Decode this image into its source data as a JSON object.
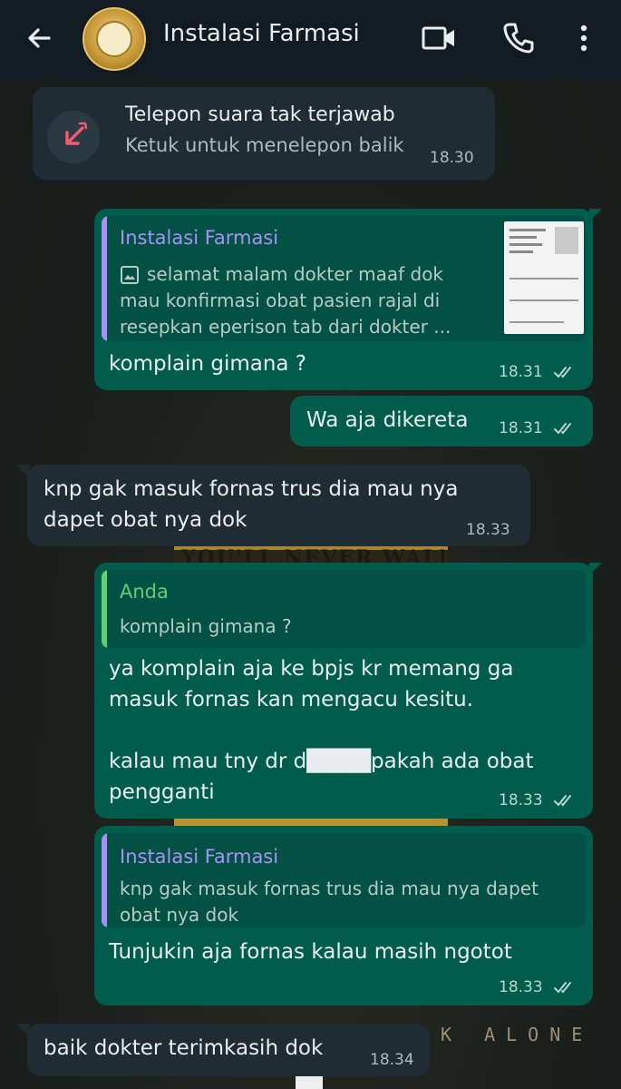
{
  "header": {
    "title": "Instalasi Farmasi"
  },
  "messages": {
    "call": {
      "title": "Telepon suara tak terjawab",
      "subtitle": "Ketuk untuk menelepon balik",
      "time": "18.30"
    },
    "m1": {
      "quote_name": "Instalasi Farmasi",
      "quote_text_1": "selamat malam dokter maaf dok",
      "quote_text_2": "mau konfirmasi obat pasien rajal di",
      "quote_text_3": "resepkan eperison tab dari dokter ...",
      "text": "komplain gimana ?",
      "time": "18.31"
    },
    "m2": {
      "text": "Wa aja dikereta",
      "time": "18.31"
    },
    "m3": {
      "text": "knp gak masuk fornas trus dia mau nya\ndapet obat nya dok",
      "time": "18.33"
    },
    "m4": {
      "quote_name": "Anda",
      "quote_text": "komplain gimana ?",
      "text": "ya komplain aja ke bpjs kr memang ga\nmasuk fornas kan mengacu kesitu.\n\nkalau mau tny dr d████pakah ada obat\npengganti",
      "time": "18.33"
    },
    "m5": {
      "quote_name": "Instalasi Farmasi",
      "quote_text_1": "knp gak masuk fornas trus dia mau nya dapet",
      "quote_text_2": "obat nya dok",
      "text": "Tunjukin aja fornas kalau masih ngotot",
      "time": "18.33"
    },
    "m6": {
      "text": "baik dokter terimkasih dok",
      "time": "18.34"
    }
  },
  "wallpaper": {
    "poster_text": "YOU'LL NEVER WALK ALONE",
    "bottom_text": "K ALONE"
  },
  "colors": {
    "header_bg": "#111b21",
    "incoming_bubble": "#202c33",
    "outgoing_bubble": "#005c4b",
    "missed_call_red": "#f15c6d",
    "quote_name_purple": "#a791f5",
    "quote_name_green": "#5fcf77",
    "read_ticks": "#b7d7cf"
  },
  "icons": {
    "back": "arrow-left-icon",
    "video": "video-call-icon",
    "call": "phone-icon",
    "menu": "more-vert-icon",
    "missed": "missed-call-icon",
    "photo": "photo-icon",
    "ticks": "double-check-icon"
  }
}
